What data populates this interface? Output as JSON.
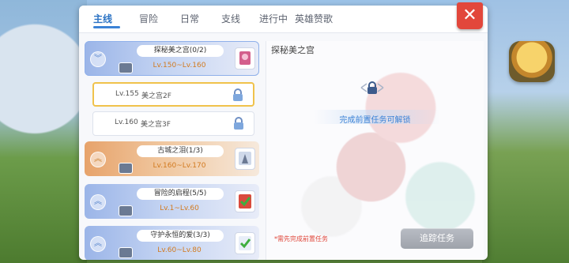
{
  "tabs": [
    {
      "label": "主线",
      "active": true
    },
    {
      "label": "冒险"
    },
    {
      "label": "日常"
    },
    {
      "label": "支线"
    },
    {
      "label": "进行中"
    },
    {
      "label": "英雄赞歌"
    }
  ],
  "close_label": "✕",
  "groups": [
    {
      "title": "探秘美之宫(0/2)",
      "level": "Lv.150~Lv.160",
      "expanded": true,
      "icon": "chart-trophy-icon",
      "tasks": [
        {
          "lv": "Lv.155",
          "name": "美之宫2F",
          "locked": true,
          "selected": true
        },
        {
          "lv": "Lv.160",
          "name": "美之宫3F",
          "locked": true
        }
      ]
    },
    {
      "title": "古城之泪(1/3)",
      "level": "Lv.160~Lv.170",
      "icon": "tower-card-icon"
    },
    {
      "title": "冒险的启程(5/5)",
      "level": "Lv.1~Lv.60",
      "icon": "completed-check-icon"
    },
    {
      "title": "守护永恒的爱(3/3)",
      "level": "Lv.60~Lv.80",
      "icon": "completed-check-icon"
    }
  ],
  "detail": {
    "title": "探秘美之宫",
    "unlock_hint": "完成前置任务可解锁",
    "note": "*需先完成前置任务",
    "track_label": "追踪任务"
  }
}
